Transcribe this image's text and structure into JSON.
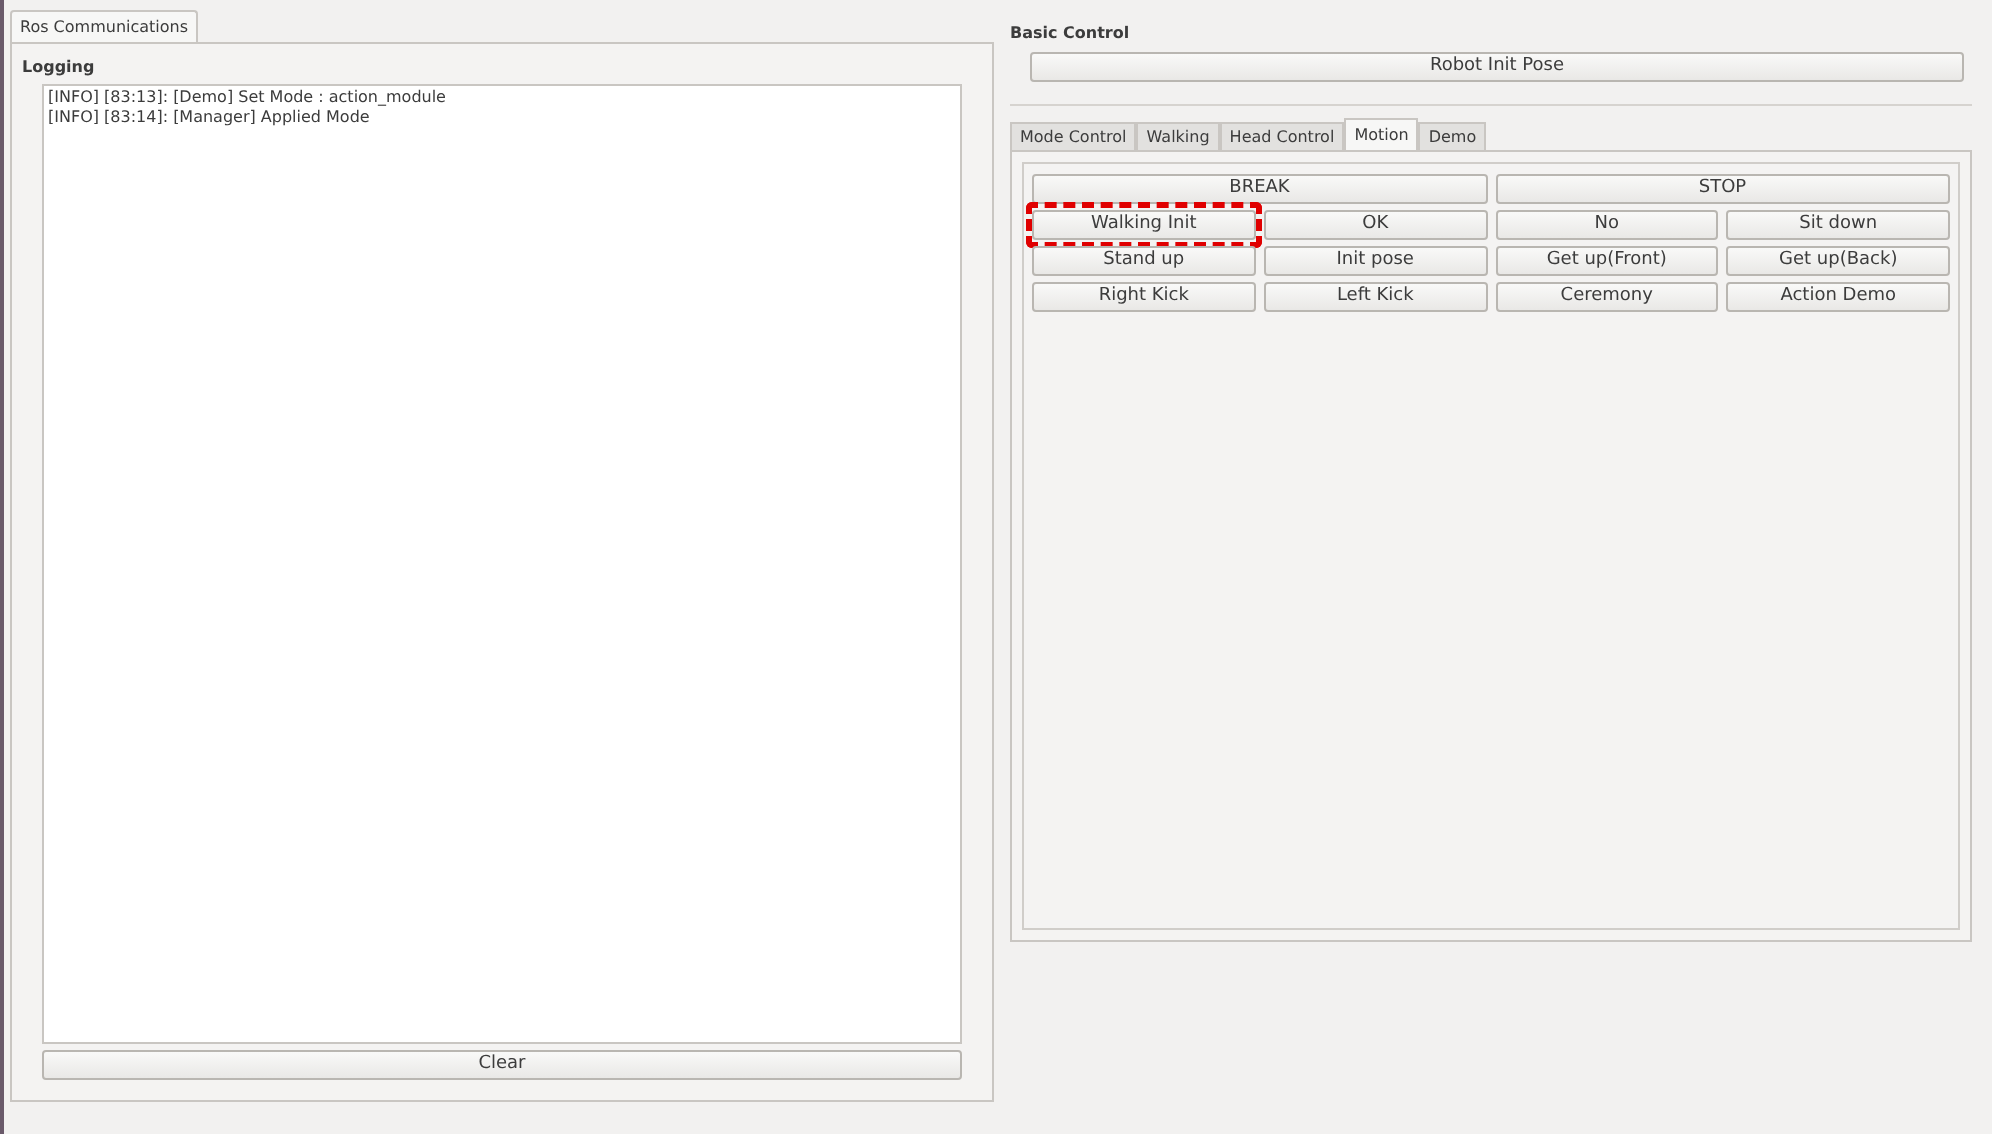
{
  "left_tabs": [
    {
      "label": "Ros Communications",
      "selected": true
    }
  ],
  "logging": {
    "title": "Logging",
    "lines": [
      "[INFO] [83:13]: [Demo] Set Mode : action_module",
      "[INFO] [83:14]: [Manager] Applied Mode"
    ],
    "clear_button": "Clear"
  },
  "basic_control": {
    "title": "Basic Control",
    "init_button": "Robot Init Pose"
  },
  "tabs": [
    {
      "label": "Mode Control",
      "selected": false
    },
    {
      "label": "Walking",
      "selected": false
    },
    {
      "label": "Head Control",
      "selected": false
    },
    {
      "label": "Motion",
      "selected": true
    },
    {
      "label": "Demo",
      "selected": false
    }
  ],
  "motion_rows": [
    [
      {
        "label": "BREAK",
        "highlighted": false
      },
      {
        "label": "STOP",
        "highlighted": false
      }
    ],
    [
      {
        "label": "Walking Init",
        "highlighted": true
      },
      {
        "label": "OK",
        "highlighted": false
      },
      {
        "label": "No",
        "highlighted": false
      },
      {
        "label": "Sit down",
        "highlighted": false
      }
    ],
    [
      {
        "label": "Stand up",
        "highlighted": false
      },
      {
        "label": "Init pose",
        "highlighted": false
      },
      {
        "label": "Get up(Front)",
        "highlighted": false
      },
      {
        "label": "Get up(Back)",
        "highlighted": false
      }
    ],
    [
      {
        "label": "Right Kick",
        "highlighted": false
      },
      {
        "label": "Left Kick",
        "highlighted": false
      },
      {
        "label": "Ceremony",
        "highlighted": false
      },
      {
        "label": "Action Demo",
        "highlighted": false
      }
    ]
  ]
}
